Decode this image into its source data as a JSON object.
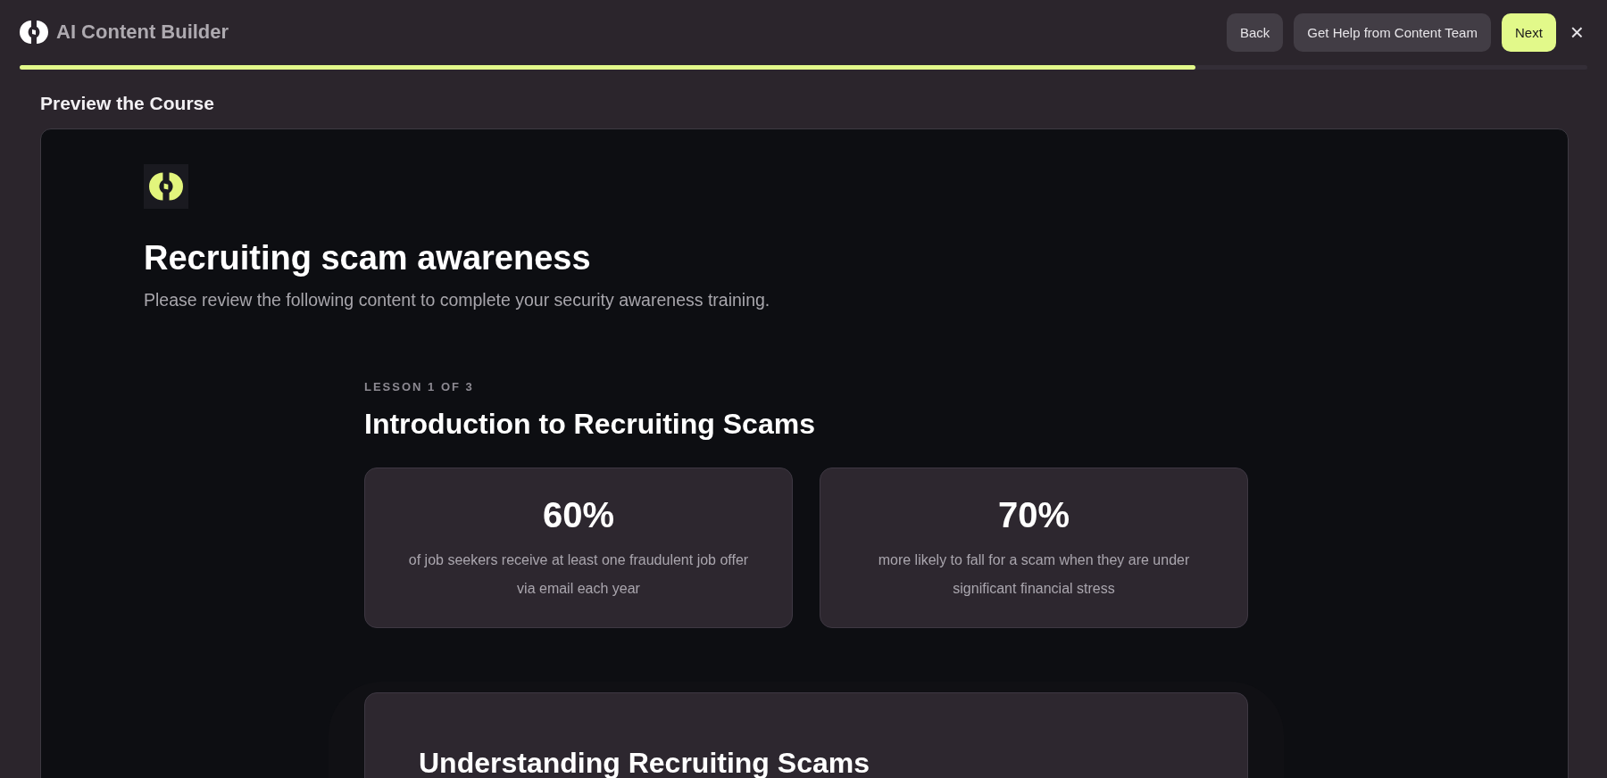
{
  "header": {
    "title": "AI Content Builder",
    "buttons": [
      {
        "label": "Back",
        "kind": "secondary"
      },
      {
        "label": "Get Help from Content Team",
        "kind": "secondary"
      },
      {
        "label": "Next",
        "kind": "primary"
      }
    ],
    "close": "×"
  },
  "progress": {
    "level": 0.75
  },
  "section_title": "Preview the Course",
  "course": {
    "title": "Recruiting scam awareness",
    "subtitle": "Please review the following content to complete your security awareness training.",
    "lesson": {
      "eyebrow": "LESSON 1 OF 3",
      "title": "Introduction to Recruiting Scams",
      "stats": [
        {
          "value": "60%",
          "text": "of job seekers receive at least one fraudulent job offer via email each year"
        },
        {
          "value": "70%",
          "text": "more likely to fall for a scam when they are under significant financial stress"
        }
      ],
      "next_card": {
        "title": "Understanding Recruiting Scams"
      }
    }
  }
}
